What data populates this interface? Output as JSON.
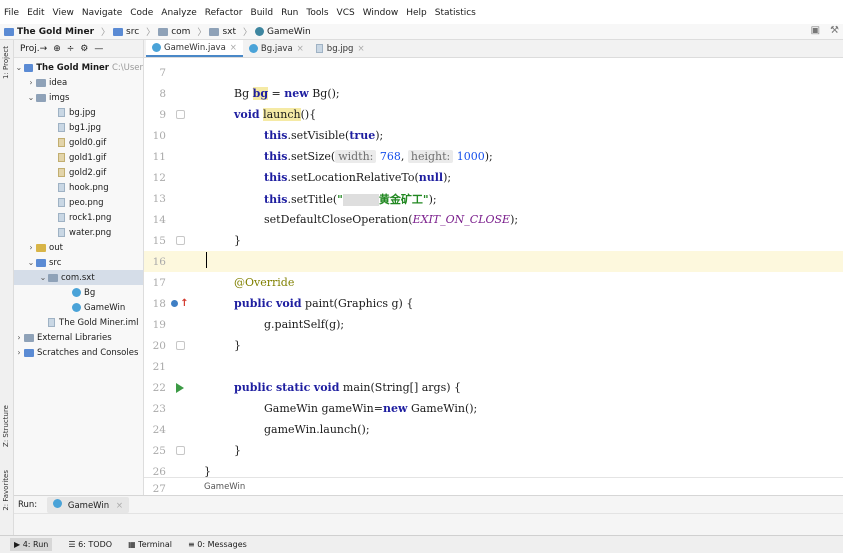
{
  "menu": [
    "File",
    "Edit",
    "View",
    "Navigate",
    "Code",
    "Analyze",
    "Refactor",
    "Build",
    "Run",
    "Tools",
    "VCS",
    "Window",
    "Help",
    "Statistics"
  ],
  "breadcrumb": {
    "project": "The Gold Miner",
    "items": [
      "src",
      "com",
      "sxt",
      "GameWin"
    ]
  },
  "project_panel": {
    "dropdown": "Proj.→",
    "root": "The Gold Miner",
    "root_path": "C:\\User",
    "tree": [
      {
        "label": "idea",
        "indent": 1
      },
      {
        "label": "imgs",
        "indent": 1
      },
      {
        "label": "bg.jpg",
        "indent": 3
      },
      {
        "label": "bg1.jpg",
        "indent": 3
      },
      {
        "label": "gold0.gif",
        "indent": 3
      },
      {
        "label": "gold1.gif",
        "indent": 3
      },
      {
        "label": "gold2.gif",
        "indent": 3
      },
      {
        "label": "hook.png",
        "indent": 3
      },
      {
        "label": "peo.png",
        "indent": 3
      },
      {
        "label": "rock1.png",
        "indent": 3
      },
      {
        "label": "water.png",
        "indent": 3
      },
      {
        "label": "out",
        "indent": 1
      },
      {
        "label": "src",
        "indent": 1
      },
      {
        "label": "com.sxt",
        "indent": 2
      },
      {
        "label": "Bg",
        "indent": 4
      },
      {
        "label": "GameWin",
        "indent": 4
      },
      {
        "label": "The Gold Miner.iml",
        "indent": 2
      },
      {
        "label": "External Libraries",
        "indent": 0
      },
      {
        "label": "Scratches and Consoles",
        "indent": 0
      }
    ]
  },
  "editor_tabs": [
    "GameWin.java",
    "Bg.java",
    "bg.jpg"
  ],
  "code": {
    "line_numbers": [
      "7",
      "8",
      "9",
      "10",
      "11",
      "12",
      "13",
      "14",
      "15",
      "16",
      "17",
      "18",
      "19",
      "20",
      "21",
      "22",
      "23",
      "24",
      "25",
      "26",
      "27"
    ],
    "bg_type": "Bg",
    "bg_var": "bg",
    "kw_new": "new",
    "bg_ctor": "Bg();",
    "kw_void": "void",
    "launch": "launch",
    "brace_open": "(){",
    "kw_this": "this",
    "set_visible": ".setVisible(",
    "kw_true": "true",
    "close_paren": ");",
    "set_size": ".setSize(",
    "hint_width": "width:",
    "val_width": "768",
    "hint_height": "height:",
    "val_height": "1000",
    "set_loc": ".setLocationRelativeTo(",
    "kw_null": "null",
    "set_title": ".setTitle(",
    "title_text": "黄金矿工",
    "default_close": "setDefaultCloseOperation(",
    "exit_on_close": "EXIT_ON_CLOSE",
    "close_brace": "}",
    "override": "@Override",
    "kw_public": "public",
    "paint_sig": "paint(Graphics g) {",
    "paint_body": "g.paintSelf(g);",
    "kw_static": "static",
    "main_sig": "main(String[] args) {",
    "gamewin_decl": "GameWin gameWin=",
    "gamewin_ctor": "GameWin();",
    "launch_call": "gameWin.launch();",
    "footer": "GameWin"
  },
  "run_panel": {
    "label": "Run:",
    "tab": "GameWin"
  },
  "bottom_tools": [
    "4: Run",
    "6: TODO",
    "Terminal",
    "0: Messages"
  ],
  "side_tabs": [
    "1: Project",
    "Z: Structure",
    "2: Favorites"
  ]
}
